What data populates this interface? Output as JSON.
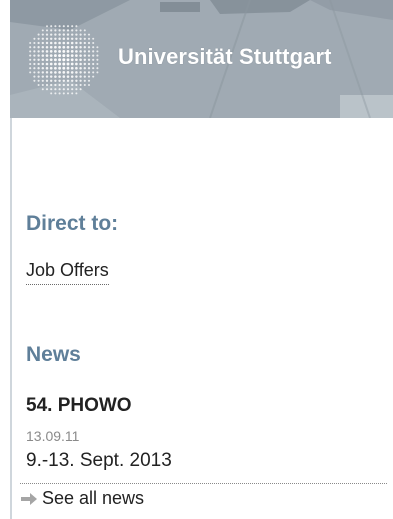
{
  "header": {
    "university_name": "Universität Stuttgart",
    "logo_icon": "university-seal-dots"
  },
  "direct_to": {
    "heading": "Direct to:",
    "links": [
      {
        "label": "Job Offers"
      }
    ]
  },
  "news": {
    "heading": "News",
    "items": [
      {
        "title": "54. PHOWO",
        "date": "13.09.11",
        "description": "9.-13. Sept. 2013"
      }
    ],
    "see_all_label": "See all news",
    "see_all_icon": "arrow-right-icon"
  },
  "colors": {
    "heading": "#5f7f99",
    "text": "#222222",
    "date": "#8a8a8a",
    "header_bg": "#9aa6b0"
  }
}
